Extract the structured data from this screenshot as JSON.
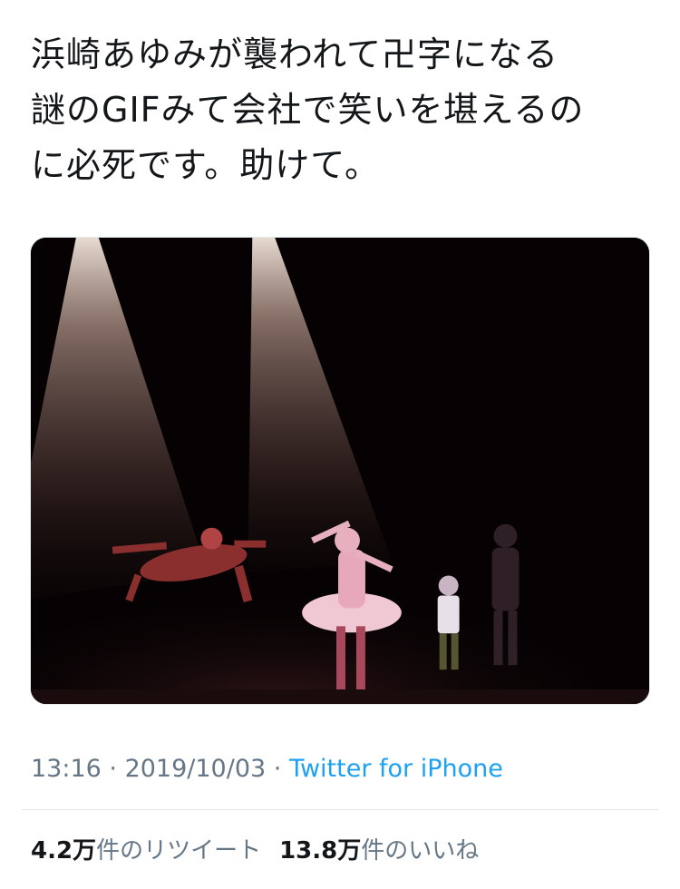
{
  "tweet": {
    "text": "浜崎あゆみが襲われて卍字になる\n謎のGIFみて会社で笑いを堪えるの\nに必死です。助けて。"
  },
  "meta": {
    "time": "13:16",
    "separator1": " · ",
    "date": "2019/10/03",
    "separator2": " · ",
    "source": "Twitter for iPhone"
  },
  "stats": {
    "retweets_count": "4.2万",
    "retweets_label": "件のリツイート",
    "likes_count": "13.8万",
    "likes_label": "件のいいね"
  },
  "colors": {
    "text": "#14171a",
    "secondary": "#657786",
    "link": "#1da1f2",
    "divider": "#e1e8ed"
  }
}
